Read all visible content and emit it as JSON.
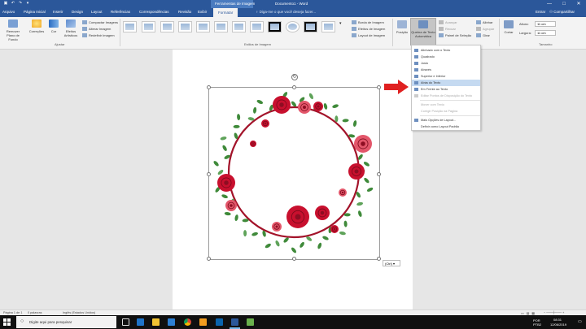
{
  "window": {
    "title": "Documento1 - Word",
    "context_tab_group": "Ferramentas de Imagem",
    "controls": [
      "—",
      "□",
      "✕"
    ]
  },
  "tabs": {
    "file": "Arquivo",
    "items": [
      "Página Inicial",
      "Inserir",
      "Design",
      "Layout",
      "Referências",
      "Correspondências",
      "Revisão",
      "Exibir"
    ],
    "active": "Formatar",
    "tell_me": "♀ Diga-me o que você deseja fazer...",
    "sign_in": "Entrar",
    "share": "Compartilhar"
  },
  "ribbon": {
    "adjust": {
      "label": "Ajustar",
      "remove_bg": "Remover Plano de Fundo",
      "corrections": "Correções",
      "color": "Cor",
      "artistic": "Efeitos Artísticos",
      "compress": "Compactar Imagens",
      "change": "Alterar Imagem",
      "reset": "Redefinir Imagem"
    },
    "styles": {
      "label": "Estilos de Imagem",
      "border": "Borda de Imagem",
      "effects": "Efeitos de Imagem",
      "layout": "Layout de Imagem"
    },
    "arrange": {
      "position": "Posição",
      "wrap": "Quebra de Texto Automática",
      "forward": "Avançar",
      "backward": "Recuar",
      "selection": "Painel de Seleção",
      "align": "Alinhar",
      "group": "Agrupar",
      "rotate": "Girar"
    },
    "size": {
      "label": "Tamanho",
      "crop": "Cortar",
      "height_label": "Altura:",
      "height": "11 cm",
      "width_label": "Largura:",
      "width": "11 cm"
    }
  },
  "wrap_menu": {
    "items": [
      {
        "label": "Alinhado com o Texto",
        "disabled": false
      },
      {
        "label": "Quadrado",
        "disabled": false
      },
      {
        "label": "Justo",
        "disabled": false
      },
      {
        "label": "Através",
        "disabled": false
      },
      {
        "label": "Superior e Inferior",
        "disabled": false
      },
      {
        "label": "Atrás do Texto",
        "disabled": false
      },
      {
        "label": "Em Frente ao Texto",
        "disabled": false
      },
      {
        "label": "Editar Pontos de Disposição do Texto",
        "disabled": true
      },
      {
        "label": "Mover com Texto",
        "disabled": true
      },
      {
        "label": "Corrigir Posição na Página",
        "disabled": true
      },
      {
        "label": "Mais Opções de Layout...",
        "disabled": false
      },
      {
        "label": "Definir como Layout Padrão",
        "disabled": false
      }
    ],
    "highlighted_index": 5
  },
  "document": {
    "paste_tag": "(Ctrl) ▾"
  },
  "status_bar": {
    "page": "Página 1 de 1",
    "words": "0 palavras",
    "language": "Inglês (Estados Unidos)"
  },
  "taskbar": {
    "search_placeholder": "Digite aqui para pesquisar",
    "lang": "POR",
    "lang2": "PTB2",
    "time": "08:31",
    "date": "12/06/2019"
  },
  "colors": {
    "brand": "#2b579a",
    "arrow": "#e02020",
    "rose": "#c8102e",
    "wreath_line": "#a3132a",
    "leaf": "#3f8a3a"
  }
}
